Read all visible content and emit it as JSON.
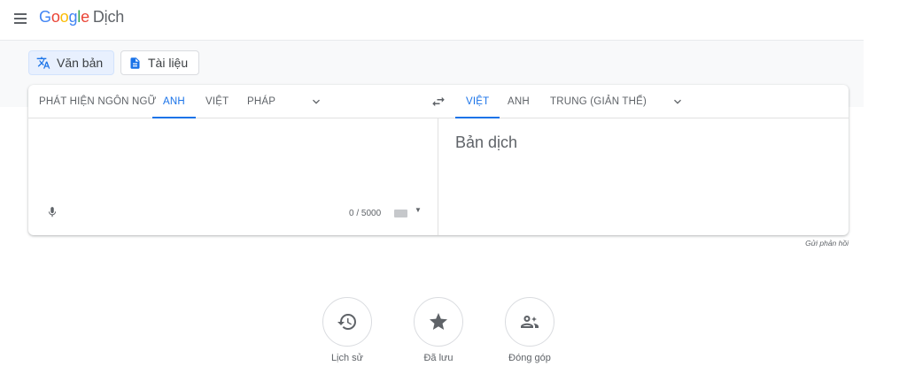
{
  "header": {
    "logo_letters": [
      "G",
      "o",
      "o",
      "g",
      "l",
      "e"
    ],
    "product_name": "Dịch"
  },
  "modes": [
    {
      "label": "Văn bản",
      "icon": "translate-icon",
      "active": true
    },
    {
      "label": "Tài liệu",
      "icon": "document-icon",
      "active": false
    }
  ],
  "source_languages": [
    "PHÁT HIỆN NGÔN NGỮ",
    "ANH",
    "VIỆT",
    "PHÁP"
  ],
  "source_active_index": 1,
  "target_languages": [
    "VIỆT",
    "ANH",
    "TRUNG (GIẢN THỂ)"
  ],
  "target_active_index": 0,
  "source": {
    "value": "",
    "char_count": "0 / 5000"
  },
  "target": {
    "placeholder": "Bản dịch"
  },
  "feedback_label": "Gửi phản hồi",
  "actions": [
    {
      "label": "Lịch sử",
      "icon": "history-icon"
    },
    {
      "label": "Đã lưu",
      "icon": "star-icon"
    },
    {
      "label": "Đóng góp",
      "icon": "contribute-icon"
    }
  ],
  "colors": {
    "accent": "#1a73e8",
    "active_mode_bg": "#e8f0fe",
    "band_bg": "#f8f9fa"
  }
}
